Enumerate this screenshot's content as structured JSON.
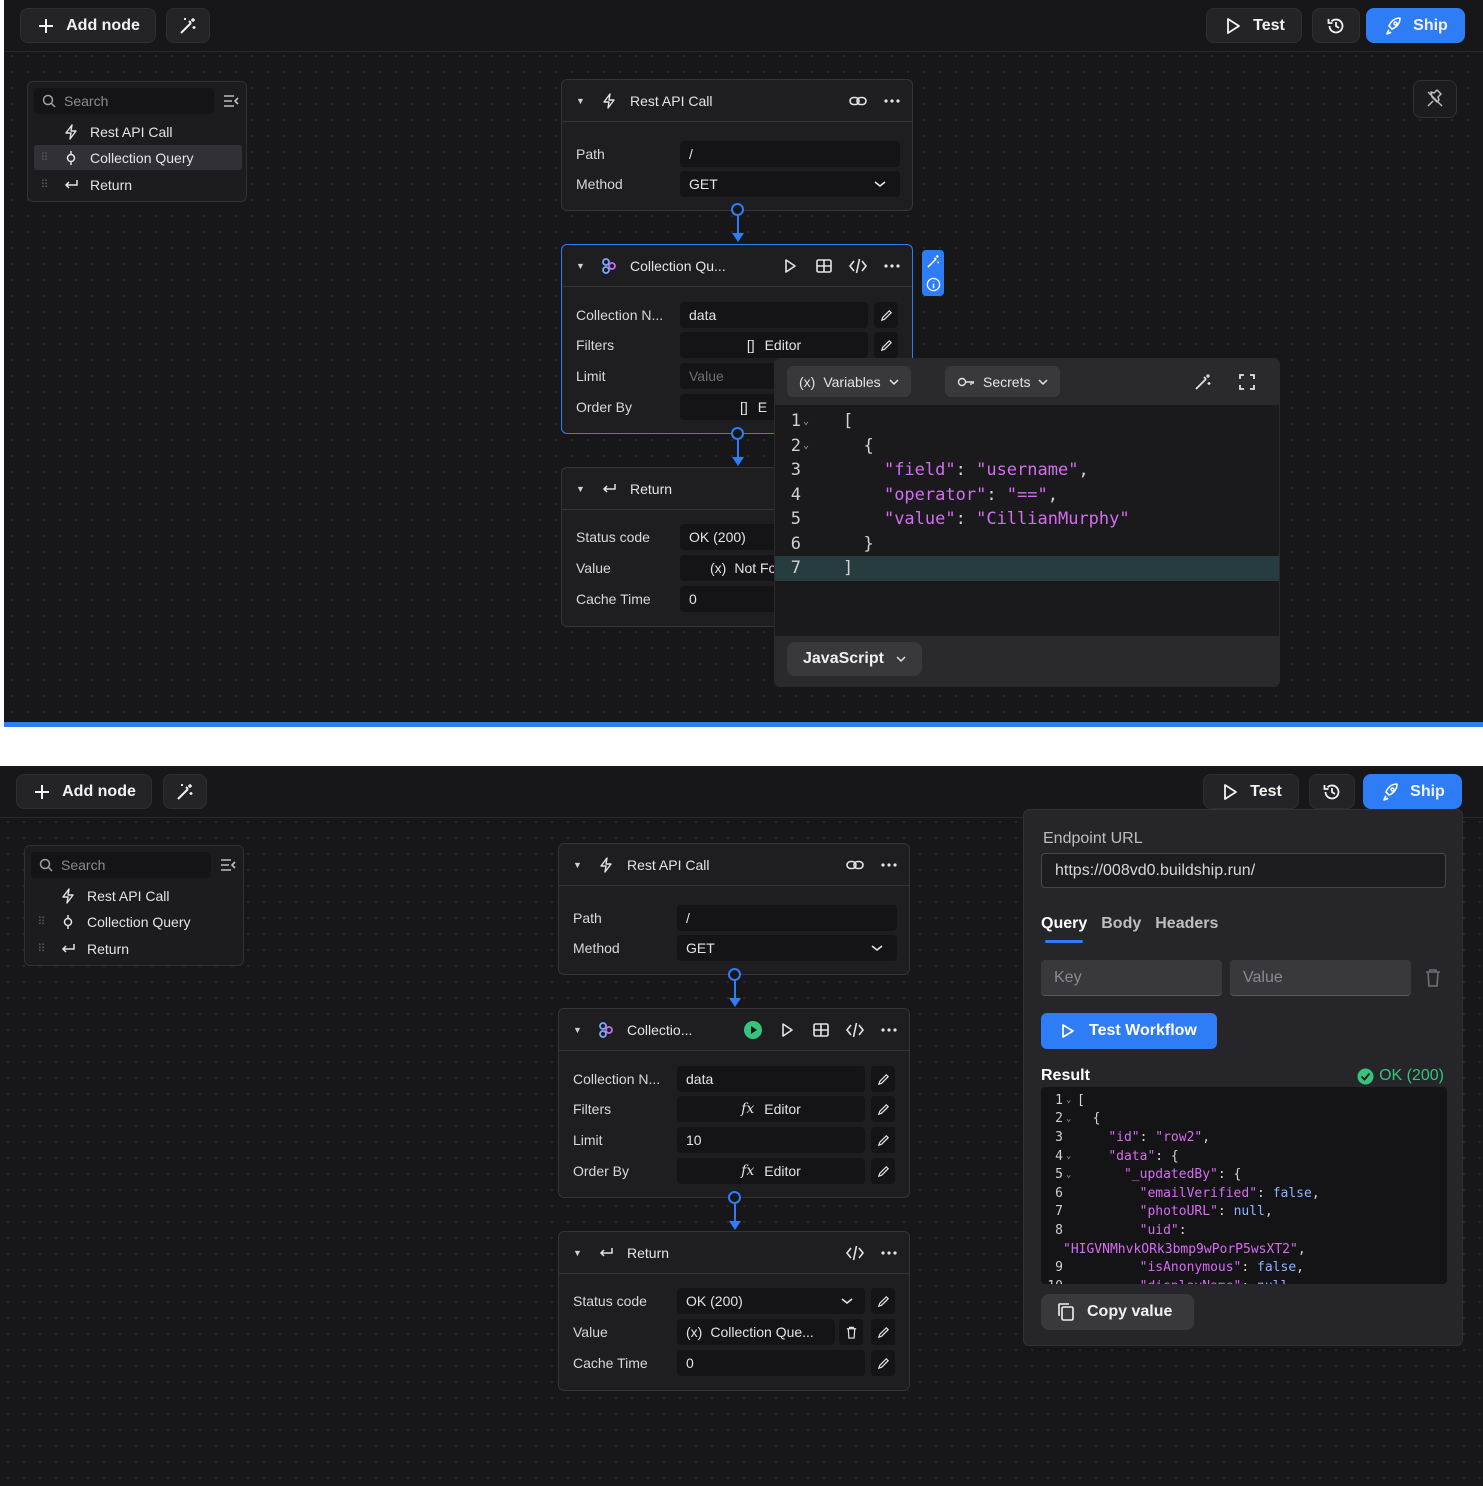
{
  "top": {
    "toolbar": {
      "add_node": "Add node",
      "test": "Test",
      "ship": "Ship"
    },
    "outline": {
      "search_placeholder": "Search",
      "items": [
        {
          "label": "Rest API Call",
          "icon": "bolt-icon"
        },
        {
          "label": "Collection Query",
          "icon": "query-icon",
          "active": true
        },
        {
          "label": "Return",
          "icon": "return-icon"
        }
      ]
    },
    "rest_node": {
      "title": "Rest API Call",
      "path_label": "Path",
      "path_value": "/",
      "method_label": "Method",
      "method_value": "GET"
    },
    "query_node": {
      "title": "Collection Qu...",
      "collection_label": "Collection N...",
      "collection_value": "data",
      "filters_label": "Filters",
      "filters_value": "Editor",
      "filters_icon": "[]",
      "limit_label": "Limit",
      "limit_placeholder": "Value",
      "orderby_label": "Order By",
      "orderby_value": "E",
      "orderby_icon": "[]"
    },
    "return_node": {
      "title": "Return",
      "status_label": "Status code",
      "status_value": "OK (200)",
      "value_label": "Value",
      "value_value": "Not Fo",
      "value_icon": "(x)",
      "cache_label": "Cache Time",
      "cache_value": "0"
    },
    "editor": {
      "variables": "Variables",
      "variables_icon": "(x)",
      "secrets": "Secrets",
      "language": "JavaScript",
      "lines": [
        {
          "n": "1",
          "fold": true,
          "text": "["
        },
        {
          "n": "2",
          "fold": true,
          "text": "  {"
        },
        {
          "n": "3",
          "text": "    \"field\": \"username\","
        },
        {
          "n": "4",
          "text": "    \"operator\": \"==\","
        },
        {
          "n": "5",
          "text": "    \"value\": \"CillianMurphy\""
        },
        {
          "n": "6",
          "text": "  }"
        },
        {
          "n": "7",
          "text": "]",
          "highlight": true
        }
      ]
    }
  },
  "bottom": {
    "toolbar": {
      "add_node": "Add node",
      "test": "Test",
      "ship": "Ship"
    },
    "outline": {
      "search_placeholder": "Search",
      "items": [
        {
          "label": "Rest API Call",
          "icon": "bolt-icon"
        },
        {
          "label": "Collection Query",
          "icon": "query-icon"
        },
        {
          "label": "Return",
          "icon": "return-icon"
        }
      ]
    },
    "rest_node": {
      "title": "Rest API Call",
      "path_label": "Path",
      "path_value": "/",
      "method_label": "Method",
      "method_value": "GET"
    },
    "query_node": {
      "title": "Collectio...",
      "collection_label": "Collection N...",
      "collection_value": "data",
      "filters_label": "Filters",
      "filters_value": "Editor",
      "filters_icon": "fx",
      "limit_label": "Limit",
      "limit_value": "10",
      "orderby_label": "Order By",
      "orderby_value": "Editor",
      "orderby_icon": "fx"
    },
    "return_node": {
      "title": "Return",
      "status_label": "Status code",
      "status_value": "OK (200)",
      "value_label": "Value",
      "value_value": "Collection Que...",
      "value_icon": "(x)",
      "cache_label": "Cache Time",
      "cache_value": "0"
    },
    "test_panel": {
      "endpoint_label": "Endpoint URL",
      "endpoint_url": "https://008vd0.buildship.run/",
      "tabs": [
        "Query",
        "Body",
        "Headers"
      ],
      "active_tab": "Query",
      "key_placeholder": "Key",
      "value_placeholder": "Value",
      "run_button": "Test Workflow",
      "result_label": "Result",
      "result_status": "OK (200)",
      "copy_button": "Copy value",
      "result_lines": [
        {
          "n": "1",
          "fold": true,
          "text": "["
        },
        {
          "n": "2",
          "fold": true,
          "text": "  {"
        },
        {
          "n": "3",
          "text": "    \"id\": \"row2\","
        },
        {
          "n": "4",
          "fold": true,
          "text": "    \"data\": {"
        },
        {
          "n": "5",
          "fold": true,
          "text": "      \"_updatedBy\": {"
        },
        {
          "n": "6",
          "text": "        \"emailVerified\": false,"
        },
        {
          "n": "7",
          "text": "        \"photoURL\": null,"
        },
        {
          "n": "8",
          "text": "        \"uid\":"
        },
        {
          "n": "",
          "text": "\"HIGVNMhvkORk3bmp9wPorP5wsXT2\","
        },
        {
          "n": "9",
          "text": "        \"isAnonymous\": false,"
        },
        {
          "n": "10",
          "text": "        \"displayName\": null"
        }
      ]
    }
  },
  "colors": {
    "accent": "#2f7df6",
    "canvas": "#17171a",
    "node": "#1e1e21",
    "ok": "#34c47c",
    "json_key": "#d66cf1"
  }
}
